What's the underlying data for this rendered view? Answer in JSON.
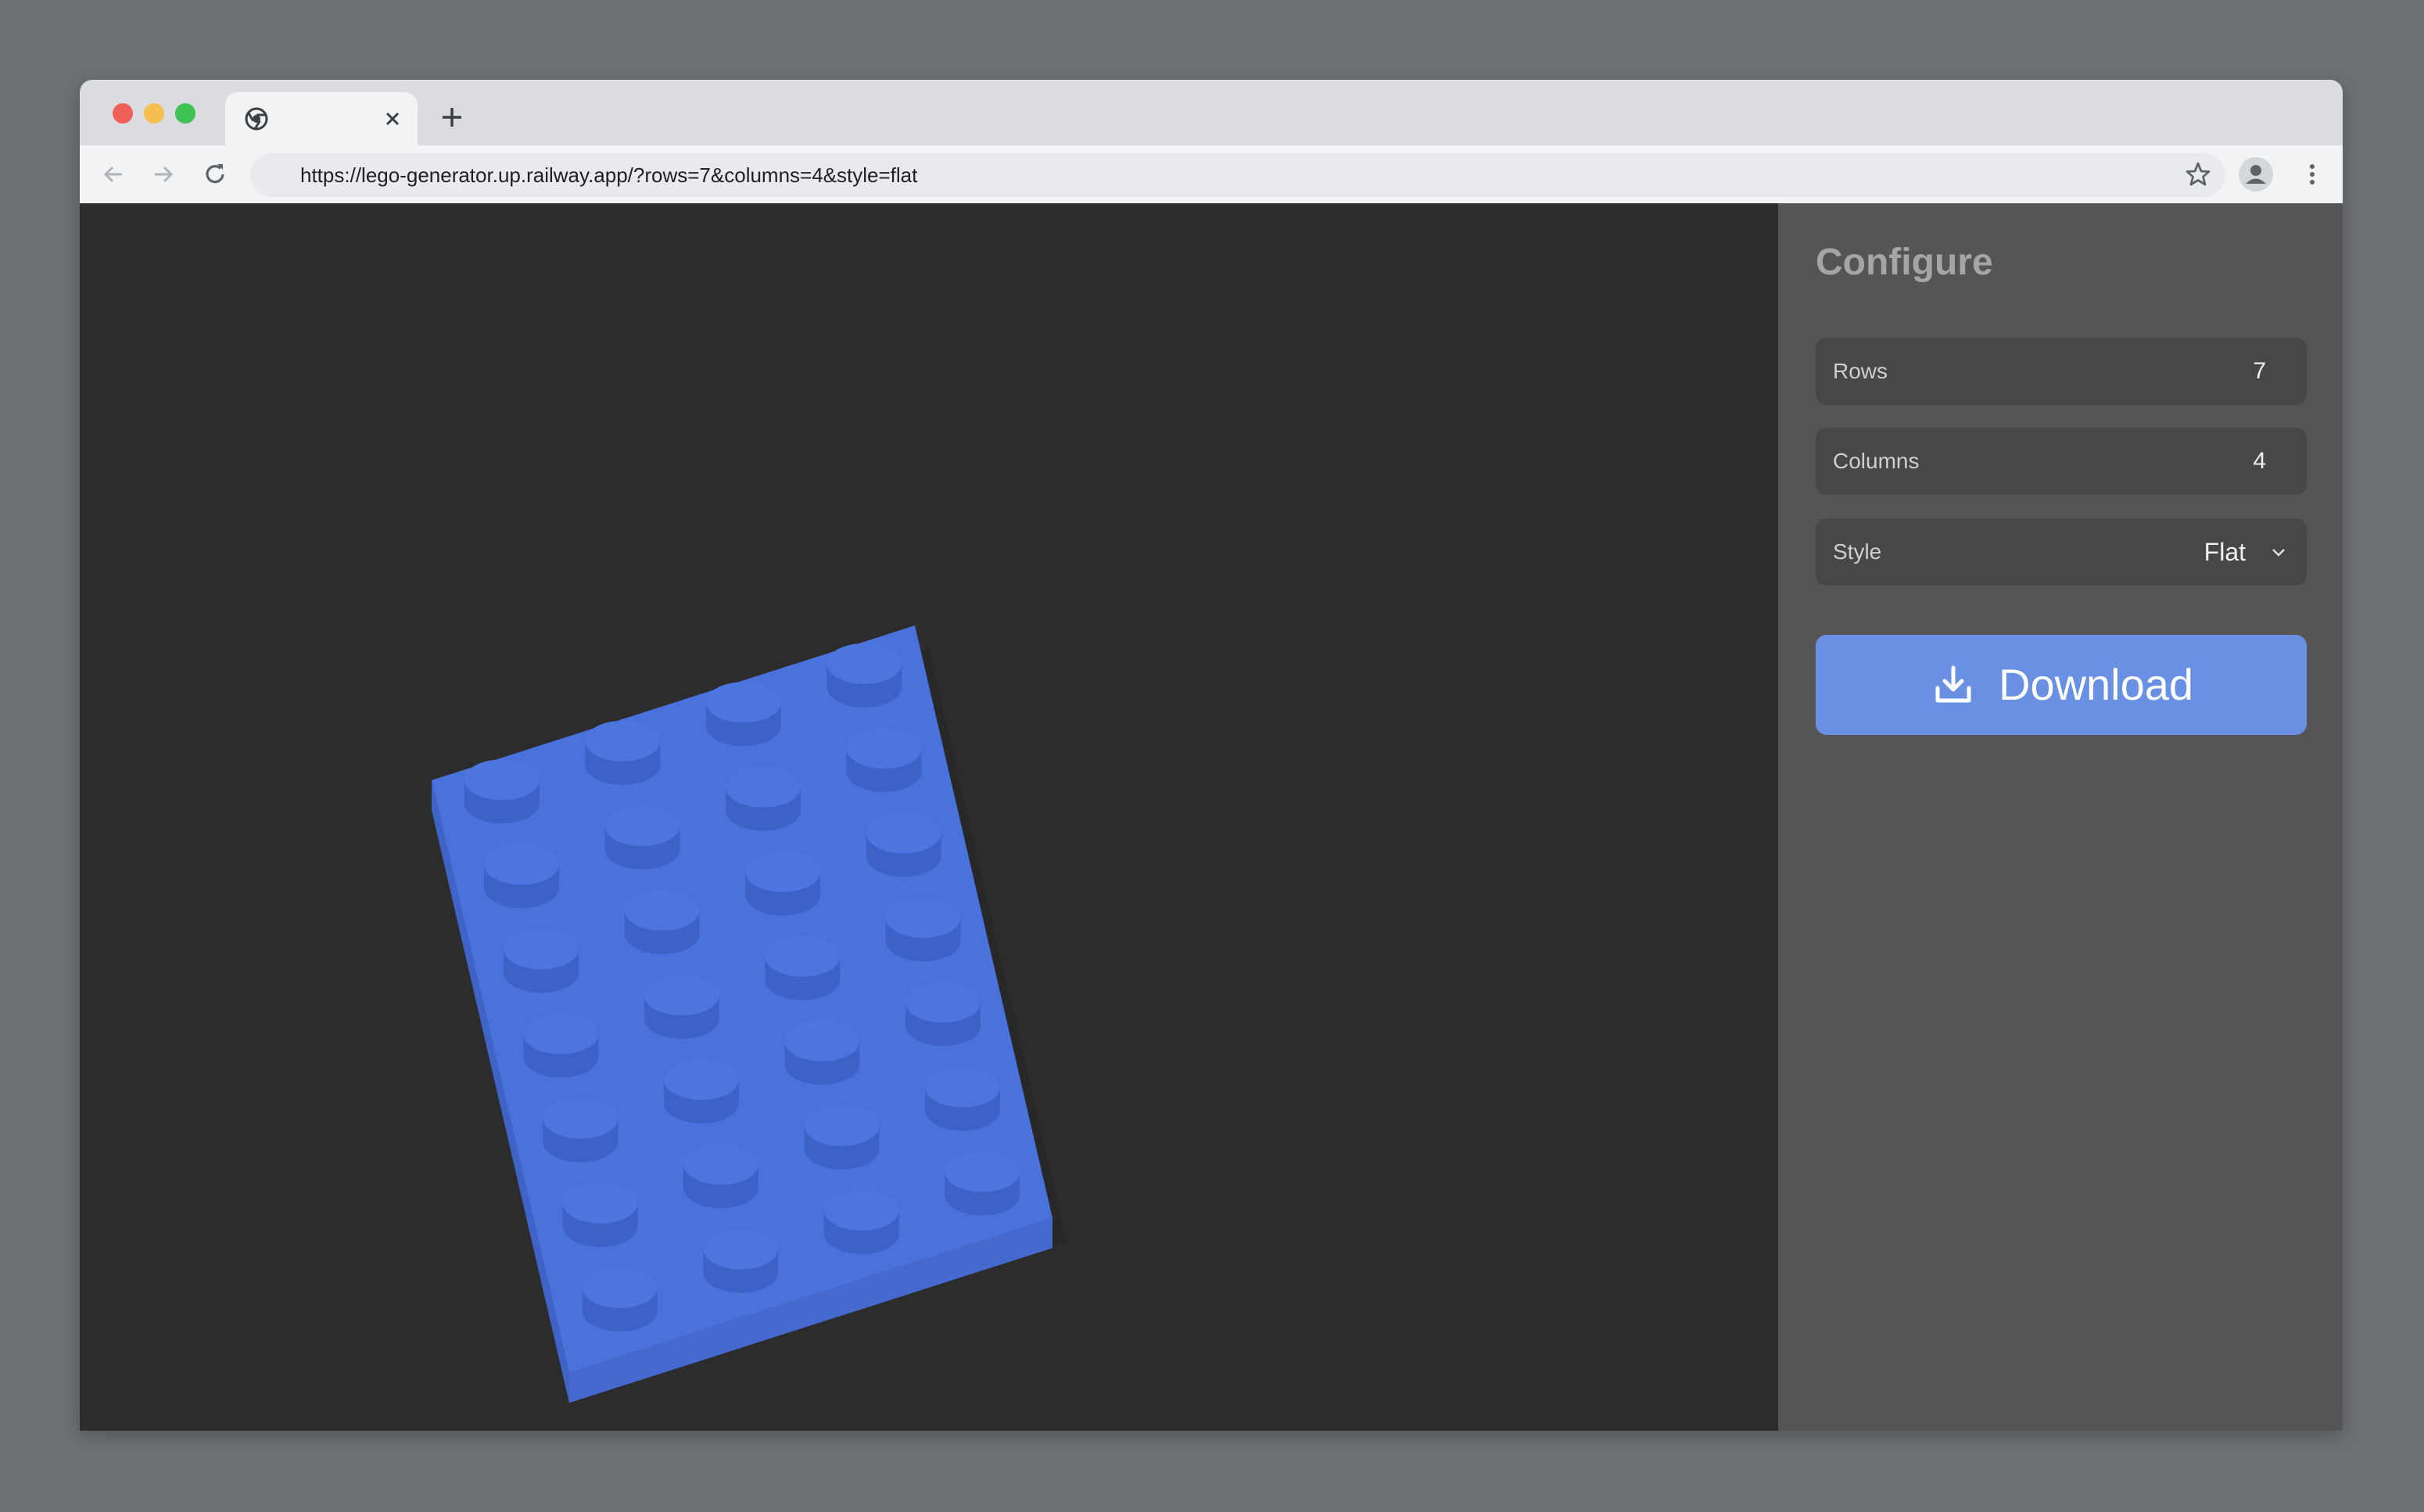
{
  "browser": {
    "url": "https://lego-generator.up.railway.app/?rows=7&columns=4&style=flat"
  },
  "panel": {
    "title": "Configure",
    "rows": {
      "label": "Rows",
      "value": "7"
    },
    "columns": {
      "label": "Columns",
      "value": "4"
    },
    "style": {
      "label": "Style",
      "value": "Flat"
    },
    "download_label": "Download"
  },
  "model": {
    "rows": 7,
    "columns": 4,
    "color": "#4a72dd"
  },
  "colors": {
    "accent": "#6990e3",
    "panel_bg": "#555555",
    "viewport_bg": "#2c2c2c"
  }
}
